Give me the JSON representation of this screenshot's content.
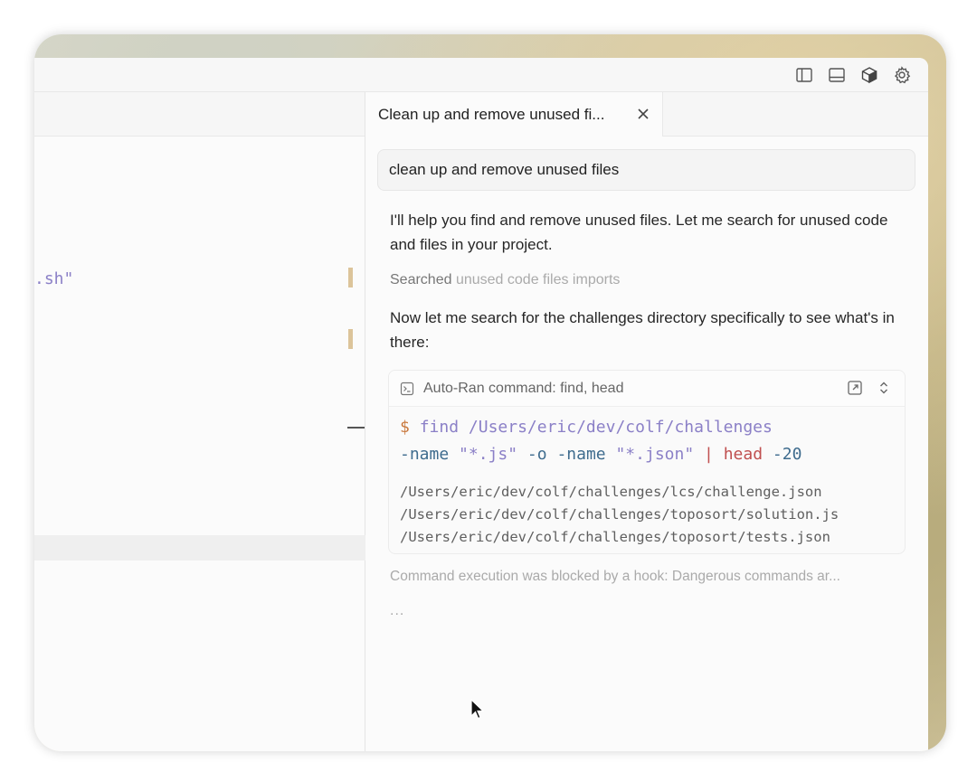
{
  "chat": {
    "tab_title": "Clean up and remove unused fi...",
    "query": "clean up and remove unused files",
    "response_1": "I'll help you find and remove unused files. Let me search for unused code and files in your project.",
    "searched_label": "Searched",
    "searched_query": "unused code files imports",
    "response_2": "Now let me search for the challenges directory specifically to see what's in there:",
    "command_card": {
      "header": "Auto-Ran command: find, head",
      "prompt": "$",
      "line1_cmd": "find",
      "line1_path": "/Users/eric/dev/colf/challenges",
      "line2_flag1": "-name",
      "line2_str1": "\"*.js\"",
      "line2_flag2": "-o",
      "line2_flag3": "-name",
      "line2_str2": "\"*.json\"",
      "line2_pipe": "|",
      "line2_head": "head",
      "line2_num": "-20",
      "output": [
        "/Users/eric/dev/colf/challenges/lcs/challenge.json",
        "/Users/eric/dev/colf/challenges/toposort/solution.js",
        "/Users/eric/dev/colf/challenges/toposort/tests.json"
      ]
    },
    "blocked_message": "Command execution was blocked by a hook: Dangerous commands ar...",
    "loading": "..."
  },
  "editor": {
    "code_fragment": ".sh\""
  },
  "icons": {
    "titlebar": [
      "sidebar-left-icon",
      "panel-bottom-icon",
      "cube-icon",
      "gear-icon"
    ],
    "card": [
      "terminal-icon",
      "open-external-icon",
      "chevron-updown-icon"
    ]
  },
  "colors": {
    "accent_mark": "#dcc49a",
    "prompt": "#c9793e",
    "command": "#8b80c7",
    "flag": "#3f6c8e",
    "pipe": "#c05050"
  }
}
